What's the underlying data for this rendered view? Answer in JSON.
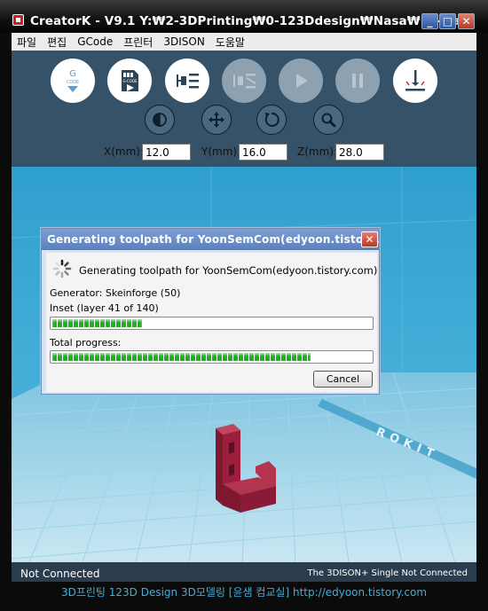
{
  "window": {
    "title": "CreatorK - V9.1  Y:₩2-3DPrinting₩0-123Ddesign₩Nasa₩10-Na...",
    "minimize": "_",
    "maximize": "□",
    "close": "✕"
  },
  "menu": {
    "items": [
      {
        "label": "파일"
      },
      {
        "label": "편집"
      },
      {
        "label": "GCode"
      },
      {
        "label": "프린터"
      },
      {
        "label": "3DISON"
      },
      {
        "label": "도움말"
      }
    ]
  },
  "toolbar": {
    "buttons": [
      {
        "icon": "gcode-download-icon",
        "label": "G",
        "sublabel": "CODE",
        "enabled": true
      },
      {
        "icon": "sd-card-gcode-icon",
        "label": "G-CODE",
        "enabled": true
      },
      {
        "icon": "connect-plug-icon",
        "enabled": true
      },
      {
        "icon": "disconnect-plug-icon",
        "enabled": false
      },
      {
        "icon": "play-icon",
        "enabled": false
      },
      {
        "icon": "pause-icon",
        "enabled": false
      },
      {
        "icon": "level-bed-icon",
        "enabled": true
      }
    ],
    "view_buttons": [
      {
        "icon": "mirror-icon"
      },
      {
        "icon": "move-arrows-icon"
      },
      {
        "icon": "rotate-icon"
      },
      {
        "icon": "zoom-icon"
      }
    ],
    "coords": {
      "x_label": "X(mm):",
      "x_value": "12.0",
      "y_label": "Y(mm):",
      "y_value": "16.0",
      "z_label": "Z(mm):",
      "z_value": "28.0"
    }
  },
  "viewport": {
    "bed_brand": "ROKIT",
    "model_color": "#9b1f3d"
  },
  "dialog": {
    "title": "Generating toolpath for YoonSemCom(edyoon.tistor...",
    "close": "✕",
    "message": "Generating toolpath for YoonSemCom(edyoon.tistory.com)",
    "generator": "Generator: Skeinforge (50)",
    "step": "Inset (layer 41 of 140)",
    "step_progress": 0.28,
    "total_label": "Total progress:",
    "total_progress": 0.81,
    "cancel": "Cancel"
  },
  "status": {
    "left": "Not Connected",
    "right": "The 3DISON+ Single Not Connected"
  },
  "footer": {
    "text": "3D프린팅 123D Design 3D모델링 [윤샘 컴교실] http://edyoon.tistory.com"
  },
  "colors": {
    "toolbar_bg": "#355268",
    "progress_green": "#21b021",
    "dialog_title": "#5b80bc"
  }
}
